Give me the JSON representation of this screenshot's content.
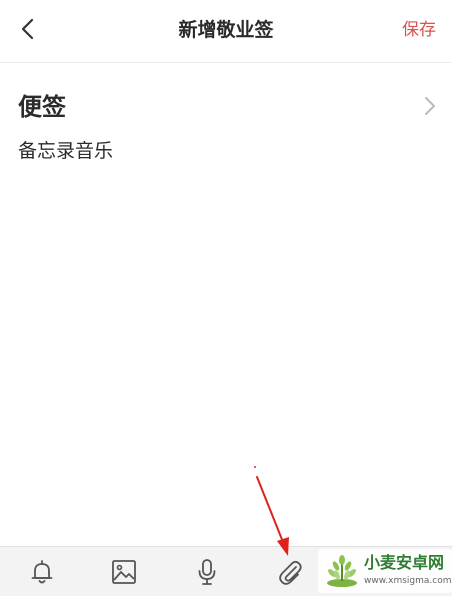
{
  "header": {
    "title": "新增敬业签",
    "save_label": "保存",
    "back_icon": "chevron-left-icon"
  },
  "note": {
    "category": "便签",
    "body": "备忘录音乐"
  },
  "toolbar": {
    "icons": [
      "bell-icon",
      "image-icon",
      "microphone-icon",
      "paperclip-icon"
    ]
  },
  "annotation": {
    "arrow_color": "#e0201b"
  },
  "watermark": {
    "brand": "小麦安卓网",
    "url": "www.xmsigma.com"
  },
  "colors": {
    "accent": "#d9534f",
    "toolbar_bg": "#f3f3f3",
    "icon": "#555555"
  }
}
